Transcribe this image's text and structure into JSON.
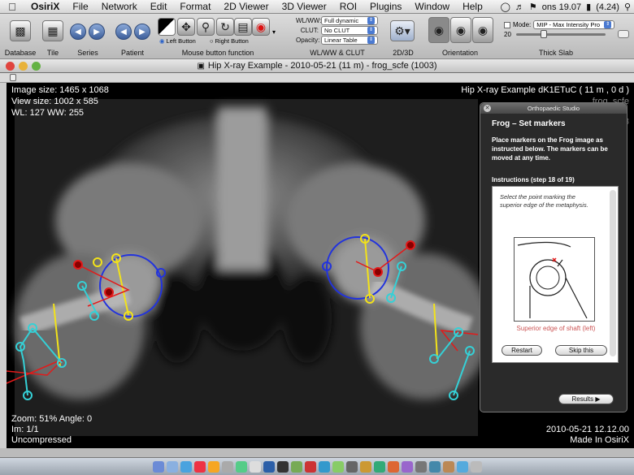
{
  "menubar": {
    "apple": "",
    "app": "OsiriX",
    "items": [
      "File",
      "Network",
      "Edit",
      "Format",
      "2D Viewer",
      "3D Viewer",
      "ROI",
      "Plugins",
      "Window",
      "Help"
    ],
    "clock": "ons 19.07",
    "battery": "(4.24)"
  },
  "toolbar": {
    "database": "Database",
    "tile": "Tile",
    "series": "Series",
    "patient": "Patient",
    "mouse_function": "Mouse button function",
    "left_button": "Left Button",
    "right_button": "Right Button",
    "wlww_label": "WL/WW:",
    "wlww_value": "Full dynamic",
    "clut_label": "CLUT:",
    "clut_value": "No CLUT",
    "opacity_label": "Opacity:",
    "opacity_value": "Linear Table",
    "wlww_clut": "WL/WW & CLUT",
    "view2d3d": "2D/3D",
    "orientation": "Orientation",
    "mode_label": "Mode:",
    "mode_value": "MIP - Max Intensity Pro",
    "slab_value": "20",
    "thick_slab": "Thick Slab"
  },
  "window": {
    "title": "Hip X-ray Example - 2010-05-21 (11 m) - frog_scfe (1003)"
  },
  "viewer": {
    "image_size": "Image size: 1465 x 1068",
    "view_size": "View size: 1002 x 585",
    "wl_ww": "WL: 127 WW: 255",
    "patient_line": "Hip X-ray Example dK1ETuC ( 11 m , 0 d )",
    "series_name": "frog_scfe",
    "series_number": "1003",
    "zoom_angle": "Zoom: 51% Angle: 0",
    "image_index": "Im: 1/1",
    "compression": "Uncompressed",
    "datetime": "2010-05-21 12.12.00",
    "made_in": "Made In OsiriX",
    "annotation": "Superior edge of shaft (left)"
  },
  "panel": {
    "title": "Orthopaedic Studio",
    "heading": "Frog – Set markers",
    "intro": "Place markers on the Frog image as instructed below. The markers can be moved at any time.",
    "instructions": "Instructions (step 18 of 19)",
    "step_text": "Select the point marking the superior edge of the metaphysis.",
    "restart": "Restart",
    "skip": "Skip this",
    "results": "Results ▶"
  },
  "colors": {
    "marker_yellow": "#f2e21a",
    "marker_cyan": "#35d0d6",
    "marker_red": "#e21a1a",
    "marker_blue": "#2233dd"
  }
}
